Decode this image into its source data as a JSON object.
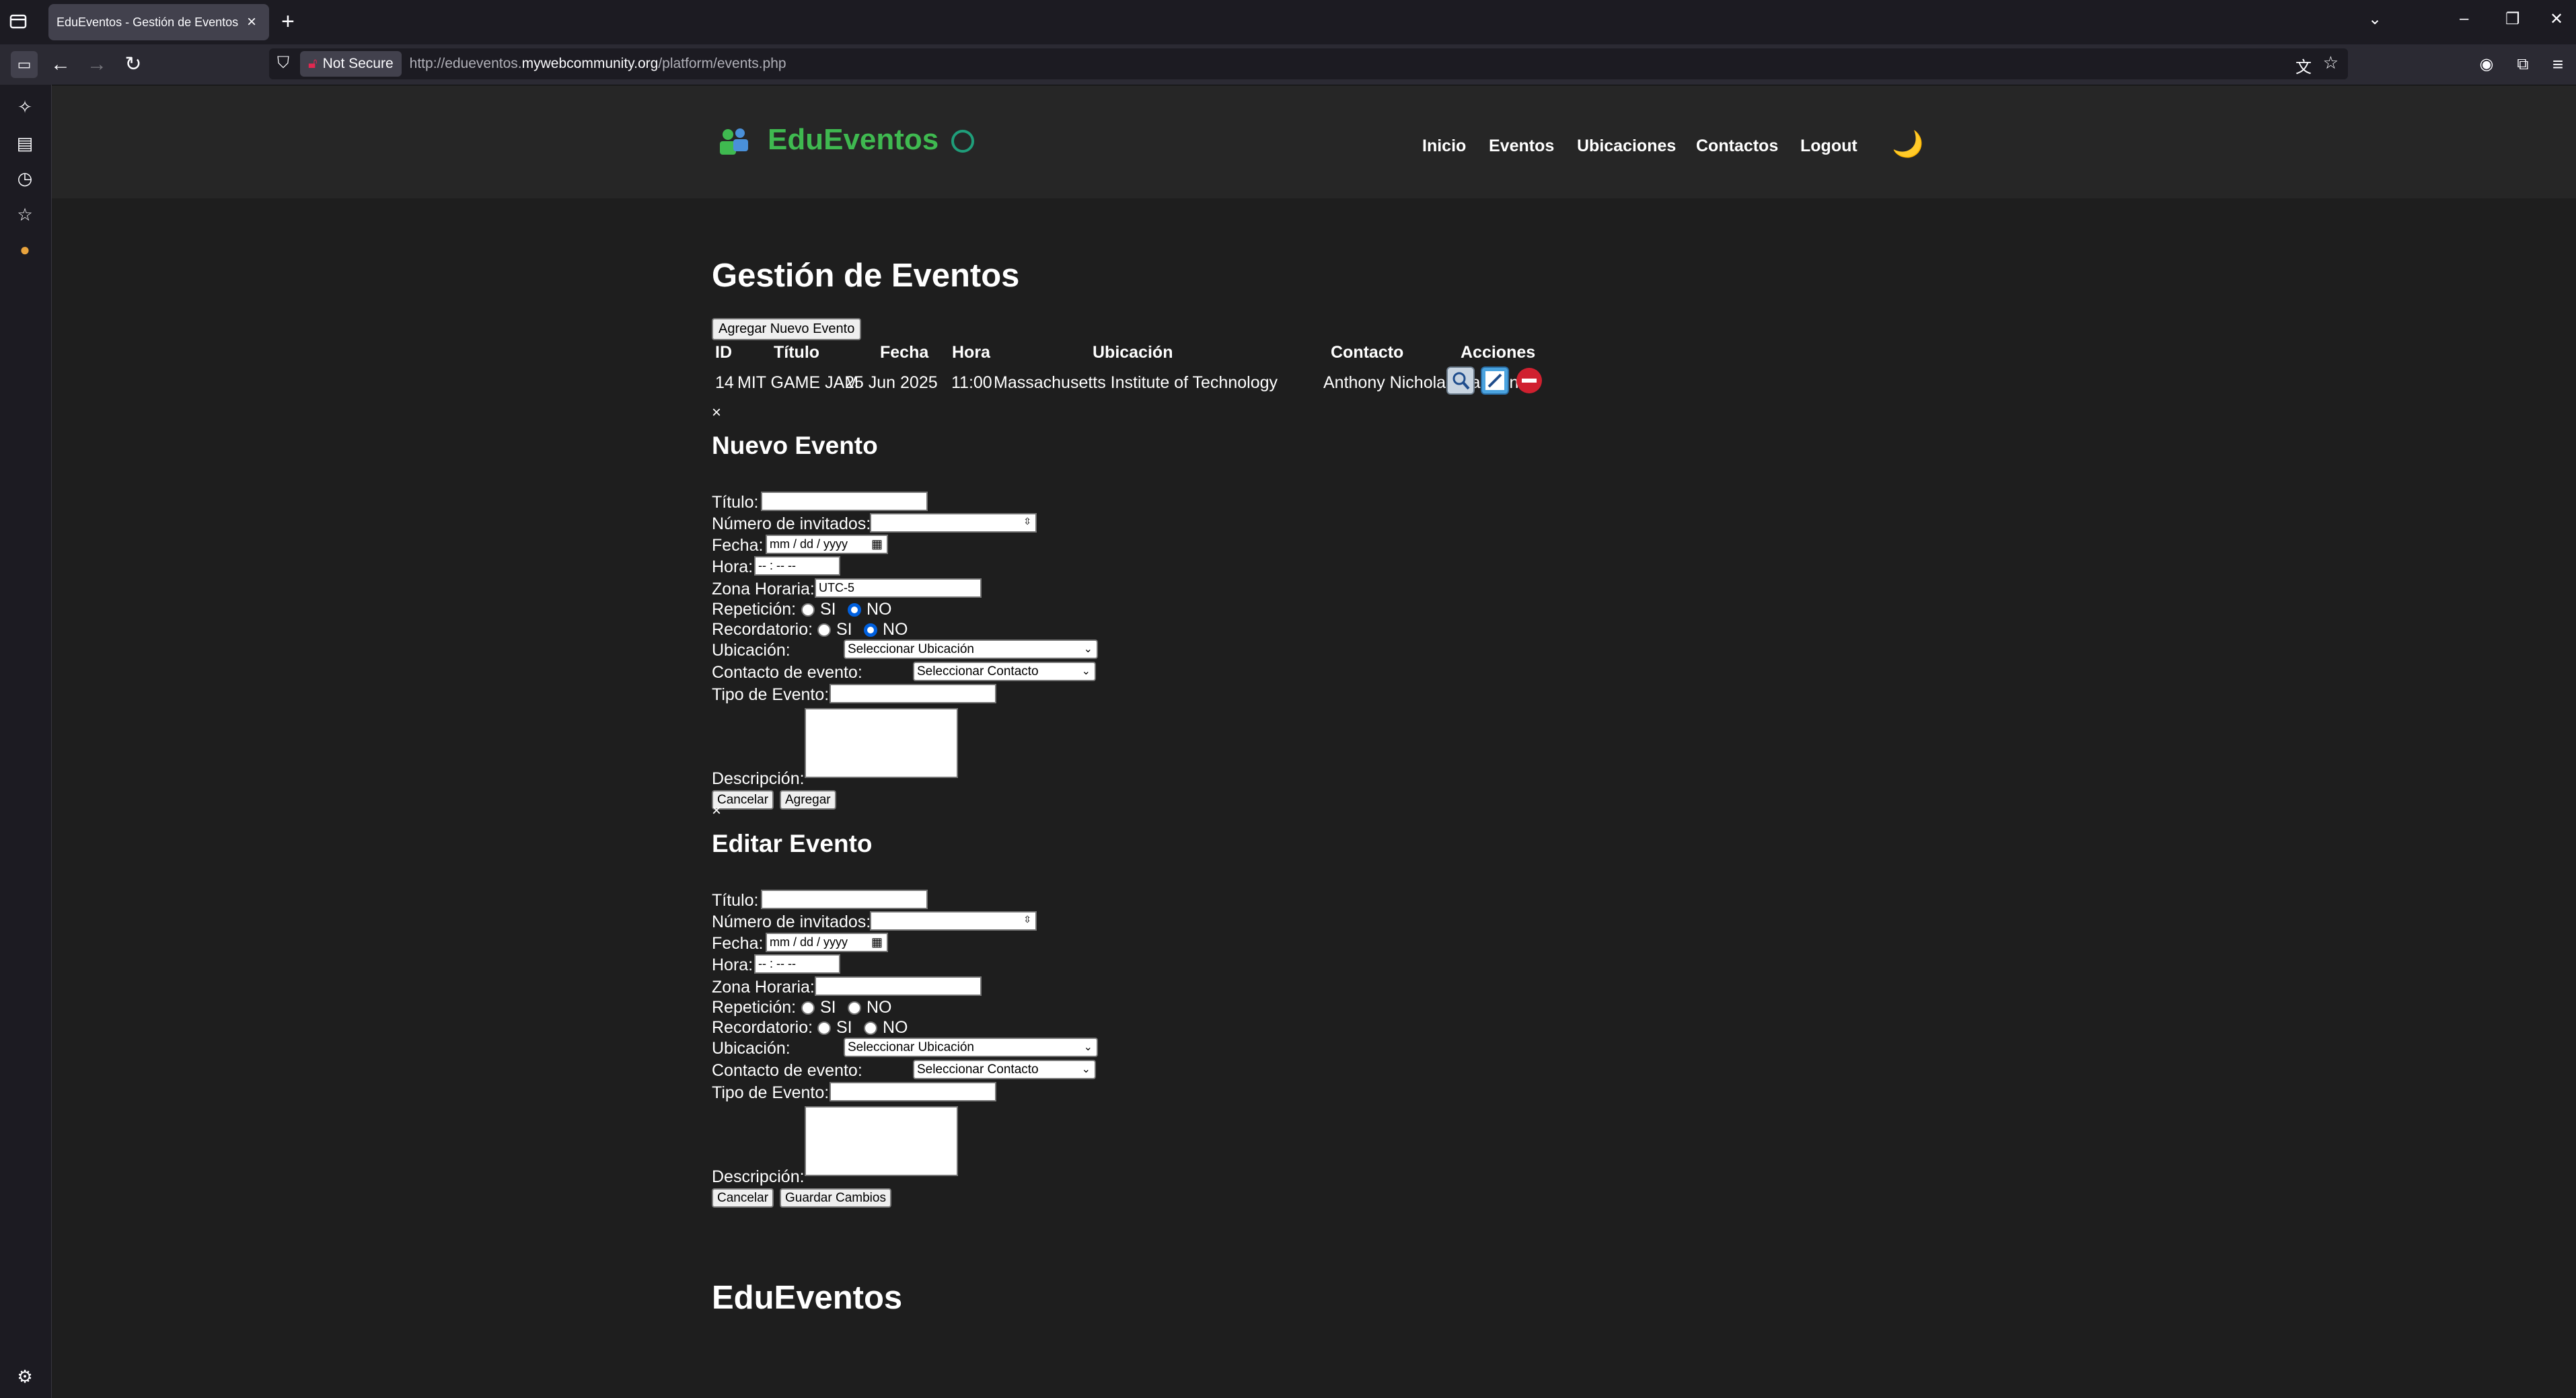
{
  "browser": {
    "tab_title": "EduEventos - Gestión de Eventos",
    "tab_close": "×",
    "new_tab": "+",
    "not_secure": "Not Secure",
    "url_prefix": "http://edueventos.",
    "url_domain": "mywebcommunity.org",
    "url_path": "/platform/events.php"
  },
  "header": {
    "brand": "EduEventos",
    "nav": [
      "Inicio",
      "Eventos",
      "Ubicaciones",
      "Contactos",
      "Logout"
    ],
    "theme_icon": "🌙"
  },
  "main": {
    "title": "Gestión de Eventos",
    "add_button": "Agregar Nuevo Evento",
    "table": {
      "headers": [
        "ID",
        "Título",
        "Fecha",
        "Hora",
        "Ubicación",
        "Contacto",
        "Acciones"
      ],
      "rows": [
        {
          "id": "14",
          "titulo": "MIT GAME JAM",
          "fecha": "25 Jun 2025",
          "hora": "11:00",
          "ubicacion": "Massachusetts Institute of Technology",
          "contacto": "Anthony Nicholas Carmen"
        }
      ]
    }
  },
  "close_x": "×",
  "new_form": {
    "heading": "Nuevo Evento",
    "labels": {
      "titulo": "Título:",
      "invitados": "Número de invitados:",
      "fecha": "Fecha:",
      "hora": "Hora:",
      "zona": "Zona Horaria:",
      "repeticion": "Repetición:",
      "recordatorio": "Recordatorio:",
      "ubicacion": "Ubicación:",
      "contacto": "Contacto de evento:",
      "tipo": "Tipo de Evento:",
      "descripcion": "Descripción:"
    },
    "date_placeholder": "mm / dd / yyyy",
    "time_placeholder": "-- : --  --",
    "zona_value": "UTC-5",
    "si": "SI",
    "no": "NO",
    "repeticion_selected": "NO",
    "recordatorio_selected": "NO",
    "ubicacion_option": "Seleccionar Ubicación",
    "contacto_option": "Seleccionar Contacto",
    "cancel": "Cancelar",
    "submit": "Agregar"
  },
  "edit_form": {
    "heading": "Editar Evento",
    "labels": {
      "titulo": "Título:",
      "invitados": "Número de invitados:",
      "fecha": "Fecha:",
      "hora": "Hora:",
      "zona": "Zona Horaria:",
      "repeticion": "Repetición:",
      "recordatorio": "Recordatorio:",
      "ubicacion": "Ubicación:",
      "contacto": "Contacto de evento:",
      "tipo": "Tipo de Evento:",
      "descripcion": "Descripción:"
    },
    "date_placeholder": "mm / dd / yyyy",
    "time_placeholder": "-- : --  --",
    "zona_value": "",
    "si": "SI",
    "no": "NO",
    "ubicacion_option": "Seleccionar Ubicación",
    "contacto_option": "Seleccionar Contacto",
    "cancel": "Cancelar",
    "submit": "Guardar Cambios"
  },
  "footer": {
    "brand": "EduEventos"
  },
  "colors": {
    "brand": "#3fb950",
    "radio_selected": "#0060df",
    "header_bg": "#262626",
    "page_bg": "#1e1e1e"
  }
}
